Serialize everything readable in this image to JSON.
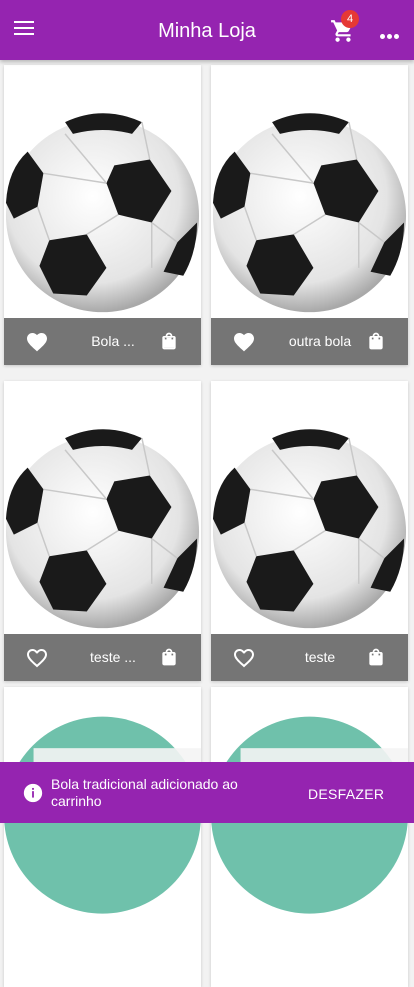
{
  "app_bar": {
    "title": "Minha Loja",
    "cart_count": "4"
  },
  "products": [
    {
      "name": "Bola ...",
      "favorite": true
    },
    {
      "name": "outra bola",
      "favorite": true
    },
    {
      "name": "teste ...",
      "favorite": false
    },
    {
      "name": "teste",
      "favorite": false
    }
  ],
  "snackbar": {
    "message": "Bola tradicional adicionado ao carrinho",
    "action": "DESFAZER"
  },
  "colors": {
    "primary": "#9524b0",
    "card_footer": "#757575",
    "badge": "#e53935",
    "partial_image": "#6fc1ab"
  }
}
